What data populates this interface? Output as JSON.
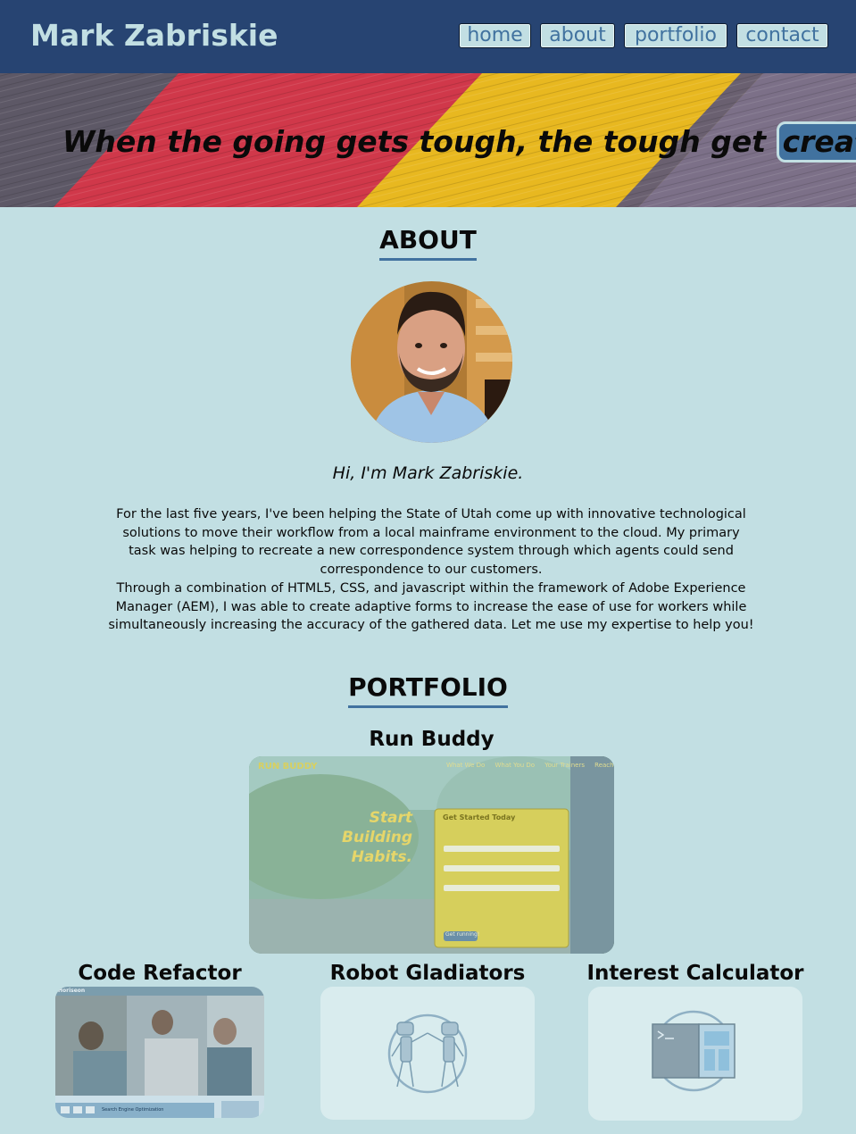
{
  "header": {
    "brand": "Mark Zabriskie",
    "nav": [
      "home",
      "about",
      "portfolio",
      "contact"
    ]
  },
  "hero": {
    "tagline_prefix": "When the going gets tough, the tough get",
    "tagline_highlight": "creative"
  },
  "about": {
    "title": "ABOUT",
    "greeting": "Hi, I'm Mark Zabriskie.",
    "paragraphs": [
      "For the last five years, I've been helping the State of Utah come up with innovative technological solutions to move their workflow from a local mainframe environment to the cloud. My primary task was helping to recreate a new correspondence system through which agents could send correspondence to our customers.",
      "Through a combination of HTML5, CSS, and javascript within the framework of Adobe Experience Manager (AEM), I was able to create adaptive forms to increase the ease of use for workers while simultaneously increasing the accuracy of the gathered data. Let me use my expertise to help you!"
    ]
  },
  "portfolio": {
    "title": "PORTFOLIO",
    "projects": [
      {
        "name": "Run Buddy",
        "screenshot": {
          "logo": "RUN BUDDY",
          "nav": [
            "What We Do",
            "What You Do",
            "Your Trainers",
            "Reach Out"
          ],
          "headline_1": "Start Building",
          "headline_2": "Habits.",
          "form_title": "Get Started Today",
          "form_button": "Get running!"
        }
      },
      {
        "name": "Code Refactor",
        "screenshot": {
          "logo": "Horiseon",
          "caption": "Search Engine Optimization"
        }
      },
      {
        "name": "Robot Gladiators"
      },
      {
        "name": "Interest Calculator"
      }
    ]
  },
  "colors": {
    "header_bg": "#274472",
    "page_bg": "#c2dfe3",
    "accent": "#41729f"
  }
}
